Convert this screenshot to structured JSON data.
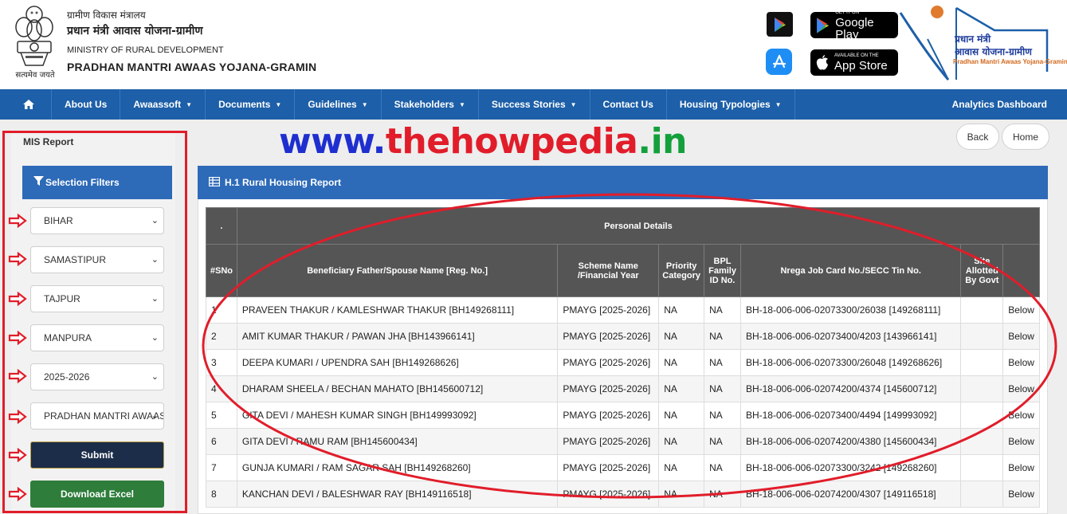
{
  "header": {
    "motto": "सत्यमेव जयते",
    "line1": "ग्रामीण विकास मंत्रालय",
    "line2": "प्रधान मंत्री आवास योजना-ग्रामीण",
    "line3": "MINISTRY OF RURAL DEVELOPMENT",
    "line4": "PRADHAN MANTRI AWAAS YOJANA-GRAMIN",
    "google_play_small": "GET IT ON",
    "google_play_big": "Google Play",
    "app_store_small": "Available on the",
    "app_store_big": "App Store",
    "logo_line1": "प्रधान मंत्री",
    "logo_line2": "आवास योजना-ग्रामीण",
    "logo_line3": "Pradhan Mantri Awaas Yojana-Gramin"
  },
  "nav": {
    "items": [
      {
        "label": "About Us",
        "dropdown": false
      },
      {
        "label": "Awaassoft",
        "dropdown": true
      },
      {
        "label": "Documents",
        "dropdown": true
      },
      {
        "label": "Guidelines",
        "dropdown": true
      },
      {
        "label": "Stakeholders",
        "dropdown": true
      },
      {
        "label": "Success Stories",
        "dropdown": true
      },
      {
        "label": "Contact Us",
        "dropdown": false
      },
      {
        "label": "Housing Typologies",
        "dropdown": true
      }
    ],
    "right": "Analytics Dashboard"
  },
  "sidebar": {
    "title": "MIS Report",
    "filters_title": "Selection Filters",
    "selects": [
      "BIHAR",
      "SAMASTIPUR",
      "TAJPUR",
      "MANPURA",
      "2025-2026",
      "PRADHAN MANTRI AWAAS YOJANA"
    ],
    "submit": "Submit",
    "download": "Download Excel"
  },
  "watermark": {
    "part1": "www.",
    "part2": "thehowpedia",
    "part3": ".in"
  },
  "buttons": {
    "back": "Back",
    "home": "Home"
  },
  "report": {
    "title": "H.1 Rural Housing Report",
    "group_header": "Personal Details",
    "group_dot": ".",
    "columns": [
      "#SNo",
      "Beneficiary Father/Spouse Name [Reg. No.]",
      "Scheme Name /Financial Year",
      "Priority Category",
      "BPL Family ID No.",
      "Nrega Job Card No./SECC Tin No.",
      "Site Allotted By Govt",
      ""
    ],
    "rows": [
      [
        "1",
        "PRAVEEN THAKUR / KAMLESHWAR THAKUR [BH149268111]",
        "PMAYG [2025-2026]",
        "NA",
        "NA",
        "BH-18-006-006-02073300/26038 [149268111]",
        "",
        "Below"
      ],
      [
        "2",
        "AMIT KUMAR THAKUR / PAWAN JHA [BH143966141]",
        "PMAYG [2025-2026]",
        "NA",
        "NA",
        "BH-18-006-006-02073400/4203 [143966141]",
        "",
        "Below"
      ],
      [
        "3",
        "DEEPA KUMARI / UPENDRA SAH [BH149268626]",
        "PMAYG [2025-2026]",
        "NA",
        "NA",
        "BH-18-006-006-02073300/26048 [149268626]",
        "",
        "Below"
      ],
      [
        "4",
        "DHARAM SHEELA / BECHAN MAHATO [BH145600712]",
        "PMAYG [2025-2026]",
        "NA",
        "NA",
        "BH-18-006-006-02074200/4374 [145600712]",
        "",
        "Below"
      ],
      [
        "5",
        "GITA DEVI / MAHESH KUMAR SINGH [BH149993092]",
        "PMAYG [2025-2026]",
        "NA",
        "NA",
        "BH-18-006-006-02073400/4494 [149993092]",
        "",
        "Below"
      ],
      [
        "6",
        "GITA DEVI / RAMU RAM [BH145600434]",
        "PMAYG [2025-2026]",
        "NA",
        "NA",
        "BH-18-006-006-02074200/4380 [145600434]",
        "",
        "Below"
      ],
      [
        "7",
        "GUNJA KUMARI / RAM SAGAR SAH [BH149268260]",
        "PMAYG [2025-2026]",
        "NA",
        "NA",
        "BH-18-006-006-02073300/3242 [149268260]",
        "",
        "Below"
      ],
      [
        "8",
        "KANCHAN DEVI / BALESHWAR RAY [BH149116518]",
        "PMAYG [2025-2026]",
        "NA",
        "NA",
        "BH-18-006-006-02074200/4307 [149116518]",
        "",
        "Below"
      ]
    ]
  },
  "colors": {
    "nav_blue": "#1d5fa8",
    "panel_blue": "#2d6ab8",
    "annotation_red": "#e11d2a",
    "table_header": "#555555"
  }
}
